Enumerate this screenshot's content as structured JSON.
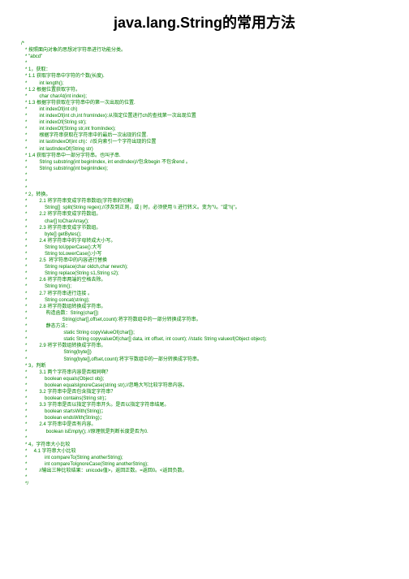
{
  "title": "java.lang.String的常用方法",
  "lines": [
    "/*",
    "   * 按照面向对象的思想对字符串进行功能分类。",
    "   * \"abcd\"",
    "   *",
    "   * 1，获取：",
    "   * 1.1 获取字符串中字符的个数(长度).",
    "   *         int length();",
    "   * 1.2 根据位置获取字符。",
    "   *         char charAt(int index);",
    "   * 1.3 根据字符获取在字符串中的第一次出现的位置.",
    "   *         int indexOf(int ch)",
    "   *         int indexOf(int ch,int fromIndex):从指定位置进行ch的查找第一次出现位置",
    "   *         int indexOf(String str);",
    "   *         int indexOf(String str,int fromIndex);",
    "   *         根据字符串获取在字符串中的最后一次出现的位置.",
    "   *         int lastIndexOf(int ch)：//反向索引一个字符出现的位置",
    "   *         int lastIndexOf(String str)",
    "   * 1.4 获取字符串中一部分字符串。也叫子串.",
    "   *         String substring(int beginIndex, int endIndex)//包含begin 不包含end 。",
    "   *         String substring(int beginIndex);",
    "   *",
    "   *",
    "   *",
    "   * 2，转换。",
    "   *         2.1 将字符串变成字符串数组(字符串的切割)",
    "   *             String[]  split(String regex);//涉及到正则，或 | 时，必须使用 \\\\ 进行转义。变为\"\\\\。\"或\"\\\\|\"。",
    "   *         2.2 将字符串变成字符数组。",
    "   *             char[] toCharArray();",
    "   *         2.3 将字符串变成字节数组。",
    "   *             byte[] getBytes();",
    "   *         2.4 将字符串中的字母转成大小写。",
    "   *             String toUpperCase():大写",
    "   *             String toLowerCase():小写",
    "   *         2.5  将字符串中的内容进行替换",
    "   *             String replace(char oldch,char newch);",
    "   *             String replace(String s1,String s2);",
    "   *         2.6 将字符串两端的空格去除。",
    "   *             String trim();",
    "   *         2.7 将字符串进行连接 。",
    "   *             String concat(string);",
    "   *         2.8 将字符数组转换成字符串。",
    "   *              构造函数：String(char[])",
    "   *                          String(char[],offset,count):将字符数组中的一部分转换成字符串。",
    "   *              静态方法：",
    "   *                           static String copyValueOf(char[]);",
    "   *                           static String copyvalueOf(char[] data, int offset, int count); //static String valueof(Object object);",
    "   *         2.9 将字节数组转换成字符串。",
    "   *                           String(byte[])",
    "   *                           String(byte[],offset,count):将字节数组中的一部分转换成字符串。",
    "   * 3，判断",
    "   *         3.1 两个字符串内容是否相同啊？",
    "   *             boolean equals(Object obj);",
    "   *             boolean equalsIgnoreCase(string str);//忽略大写比较字符串内容。",
    "   *         3.2 字符串中是否包含指定字符串？",
    "   *             boolean contains(String str)；",
    "   *         3.3 字符串是否以指定字符串开头。是否以指定字符串结尾。",
    "   *             boolean startsWith(String)；",
    "   *             boolean endsWith(String)；",
    "   *         2.4 字符串中是否有内容。",
    "   *              boolean isEmpty(); //原理就是判断长度是否为0.",
    "   *",
    "   * 4，字符串大小比较",
    "   *     4.1 字符串大小比较",
    "   *             int compareTo(String anotherString);",
    "   *             int compareToIgnoreCase(String anotherString);",
    "   *         //输出三种比较结果：unicode值>，返回正数。=返回0。<返回负数。",
    "   *",
    "   */"
  ]
}
